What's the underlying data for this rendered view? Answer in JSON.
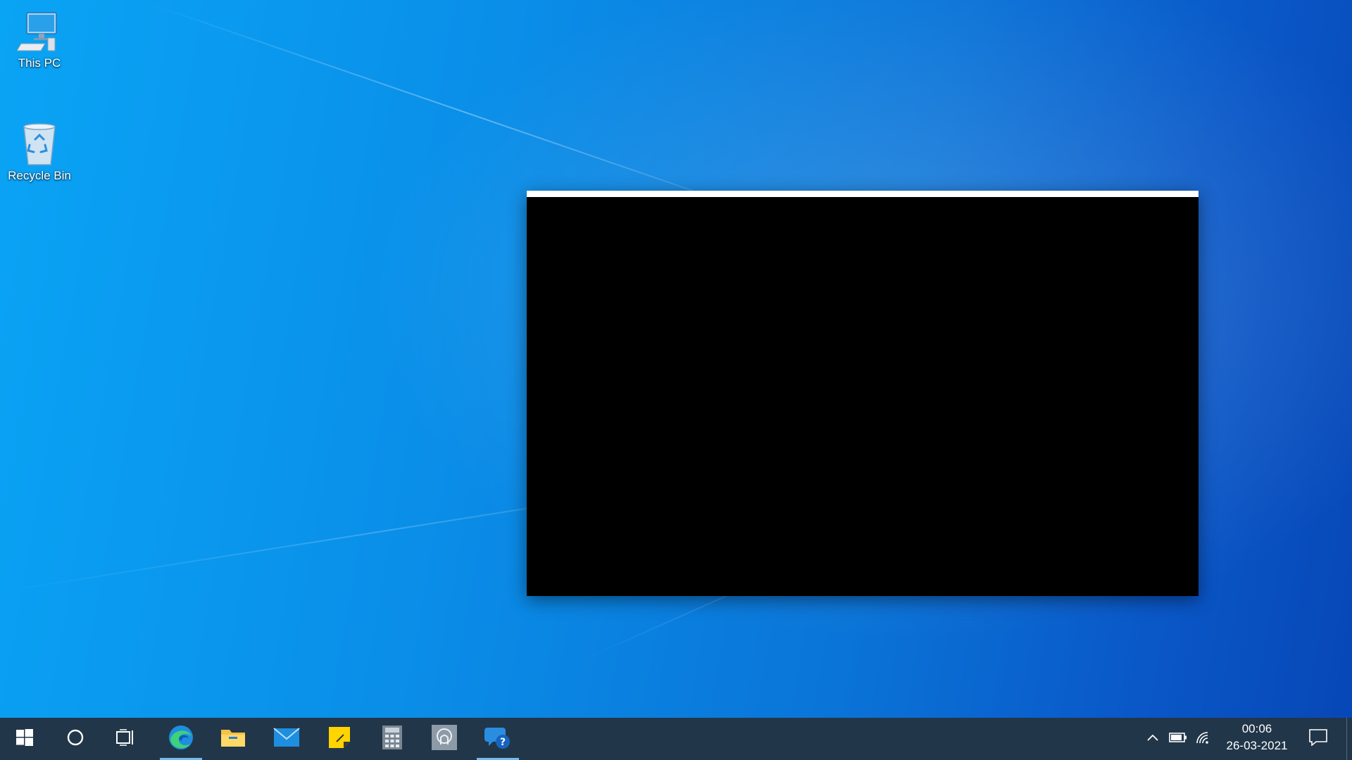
{
  "desktop": {
    "icons": [
      {
        "label": "This PC",
        "icon": "computer-icon"
      },
      {
        "label": "Recycle Bin",
        "icon": "recycle-bin-icon"
      }
    ]
  },
  "taskbar": {
    "apps": [
      {
        "icon": "windows-start-icon"
      },
      {
        "icon": "cortana-search-icon"
      },
      {
        "icon": "task-view-icon"
      },
      {
        "icon": "edge-icon",
        "active": true
      },
      {
        "icon": "file-explorer-icon"
      },
      {
        "icon": "mail-icon"
      },
      {
        "icon": "sticky-notes-icon"
      },
      {
        "icon": "calculator-icon"
      },
      {
        "icon": "app-icon"
      },
      {
        "icon": "get-help-icon",
        "active": true
      }
    ],
    "tray": {
      "icons": [
        "chevron-up-icon",
        "battery-icon",
        "wifi-icon",
        "notification-icon"
      ],
      "time": "00:06",
      "date": "26-03-2021"
    }
  },
  "colors": {
    "taskbar": "#223649",
    "active_indicator": "#76b9ed"
  }
}
